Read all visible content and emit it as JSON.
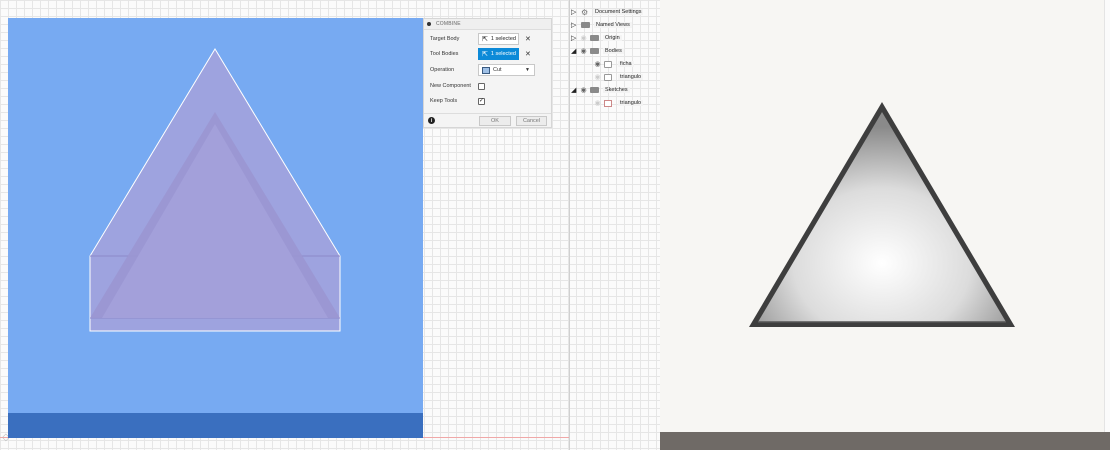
{
  "dialog": {
    "title": "COMBINE",
    "target_body_label": "Target Body",
    "target_body_value": "1 selected",
    "tool_bodies_label": "Tool Bodies",
    "tool_bodies_value": "1 selected",
    "operation_label": "Operation",
    "operation_value": "Cut",
    "new_component_label": "New Component",
    "new_component_checked": false,
    "keep_tools_label": "Keep Tools",
    "keep_tools_checked": true,
    "ok_label": "OK",
    "cancel_label": "Cancel"
  },
  "browser": {
    "document_settings": "Document Settings",
    "named_views": "Named Views",
    "origin": "Origin",
    "bodies": "Bodies",
    "body_1": "ficha",
    "body_2": "triangulo",
    "sketches": "Sketches",
    "sketch_1": "triangulo"
  },
  "colors": {
    "viewport_blue": "#77aaf2",
    "selection_accent": "#0c8ad8",
    "body_purple": "#a8a4dc"
  }
}
